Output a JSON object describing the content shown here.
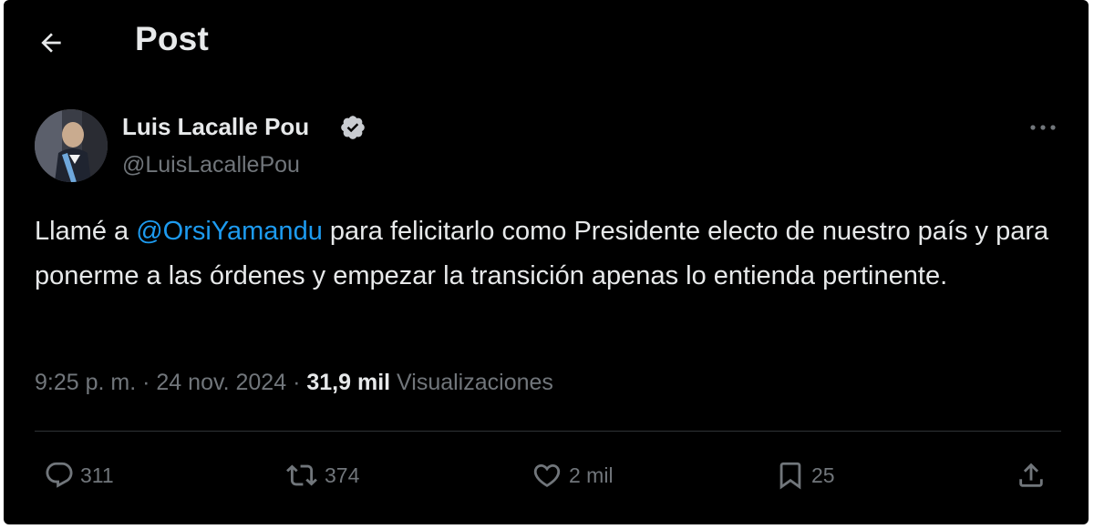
{
  "header": {
    "title": "Post",
    "back_icon": "arrow-left-icon"
  },
  "author": {
    "name": "Luis Lacalle Pou",
    "handle": "@LuisLacallePou",
    "verified_icon": "verified-badge-icon",
    "verified_color": "#1d9bf0"
  },
  "tweet": {
    "text_before": "Llamé a ",
    "mention": "@OrsiYamandu",
    "text_after": " para felicitarlo como Presidente electo de nuestro país y para ponerme a las órdenes y empezar la transición apenas lo entienda pertinente.",
    "time": "9:25 p. m.",
    "separator": "·",
    "date": "24 nov. 2024",
    "views_count": "31,9 mil",
    "views_label": "Visualizaciones"
  },
  "actions": {
    "replies": "311",
    "reposts": "374",
    "likes": "2 mil",
    "bookmarks": "25"
  },
  "colors": {
    "background": "#000000",
    "text_primary": "#e7e9ea",
    "text_secondary": "#71767b",
    "accent": "#1d9bf0",
    "divider": "#2f3336"
  }
}
